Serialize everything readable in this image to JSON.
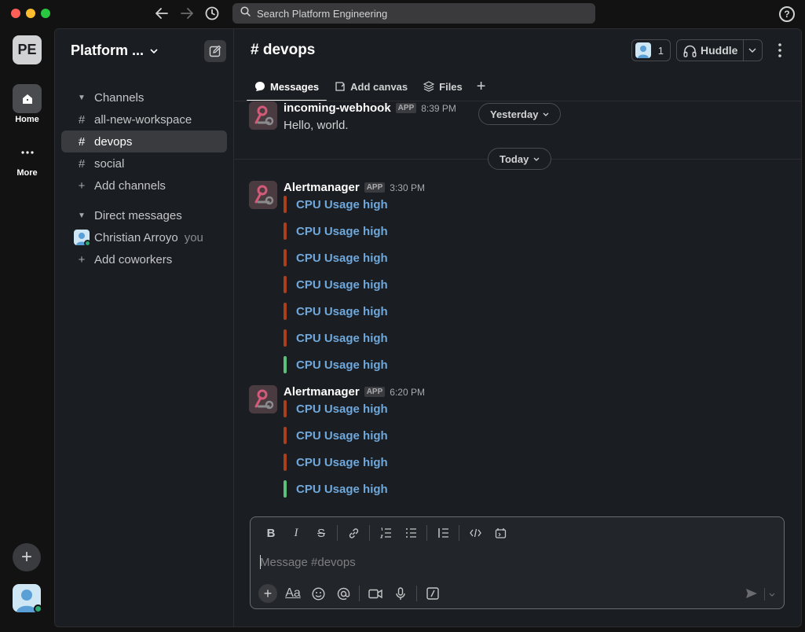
{
  "titlebar": {
    "search_placeholder": "Search Platform Engineering",
    "help_label": "?"
  },
  "rail": {
    "workspace_initials": "PE",
    "home_label": "Home",
    "more_label": "More"
  },
  "sidebar": {
    "workspace_name": "Platform ...",
    "channels_header": "Channels",
    "channels": [
      {
        "name": "all-new-workspace",
        "active": false
      },
      {
        "name": "devops",
        "active": true
      },
      {
        "name": "social",
        "active": false
      }
    ],
    "add_channels": "Add channels",
    "dm_header": "Direct messages",
    "dm_user": "Christian Arroyo",
    "dm_you": "you",
    "add_coworkers": "Add coworkers"
  },
  "channel": {
    "title": "# devops",
    "member_count": "1",
    "huddle_label": "Huddle",
    "tabs": [
      "Messages",
      "Add canvas",
      "Files"
    ]
  },
  "messages": {
    "first": {
      "sender": "incoming-webhook",
      "badge": "APP",
      "time": "8:39 PM",
      "text": "Hello, world."
    },
    "yesterday_label": "Yesterday",
    "today_label": "Today",
    "second": {
      "sender": "Alertmanager",
      "badge": "APP",
      "time": "3:30 PM",
      "alerts": [
        {
          "text": "CPU Usage high",
          "color": "#a8401a"
        },
        {
          "text": "CPU Usage high",
          "color": "#a8401a"
        },
        {
          "text": "CPU Usage high",
          "color": "#a8401a"
        },
        {
          "text": "CPU Usage high",
          "color": "#a8401a"
        },
        {
          "text": "CPU Usage high",
          "color": "#a8401a"
        },
        {
          "text": "CPU Usage high",
          "color": "#a8401a"
        },
        {
          "text": "CPU Usage high",
          "color": "#5cbf7a"
        }
      ]
    },
    "third": {
      "sender": "Alertmanager",
      "badge": "APP",
      "time": "6:20 PM",
      "alerts": [
        {
          "text": "CPU Usage high",
          "color": "#a8401a"
        },
        {
          "text": "CPU Usage high",
          "color": "#a8401a"
        },
        {
          "text": "CPU Usage high",
          "color": "#a8401a"
        },
        {
          "text": "CPU Usage high",
          "color": "#5cbf7a"
        }
      ]
    }
  },
  "composer": {
    "placeholder": "Message #devops"
  },
  "colors": {
    "link": "#6fa8dc",
    "alert_red": "#a8401a",
    "alert_green": "#5cbf7a"
  }
}
